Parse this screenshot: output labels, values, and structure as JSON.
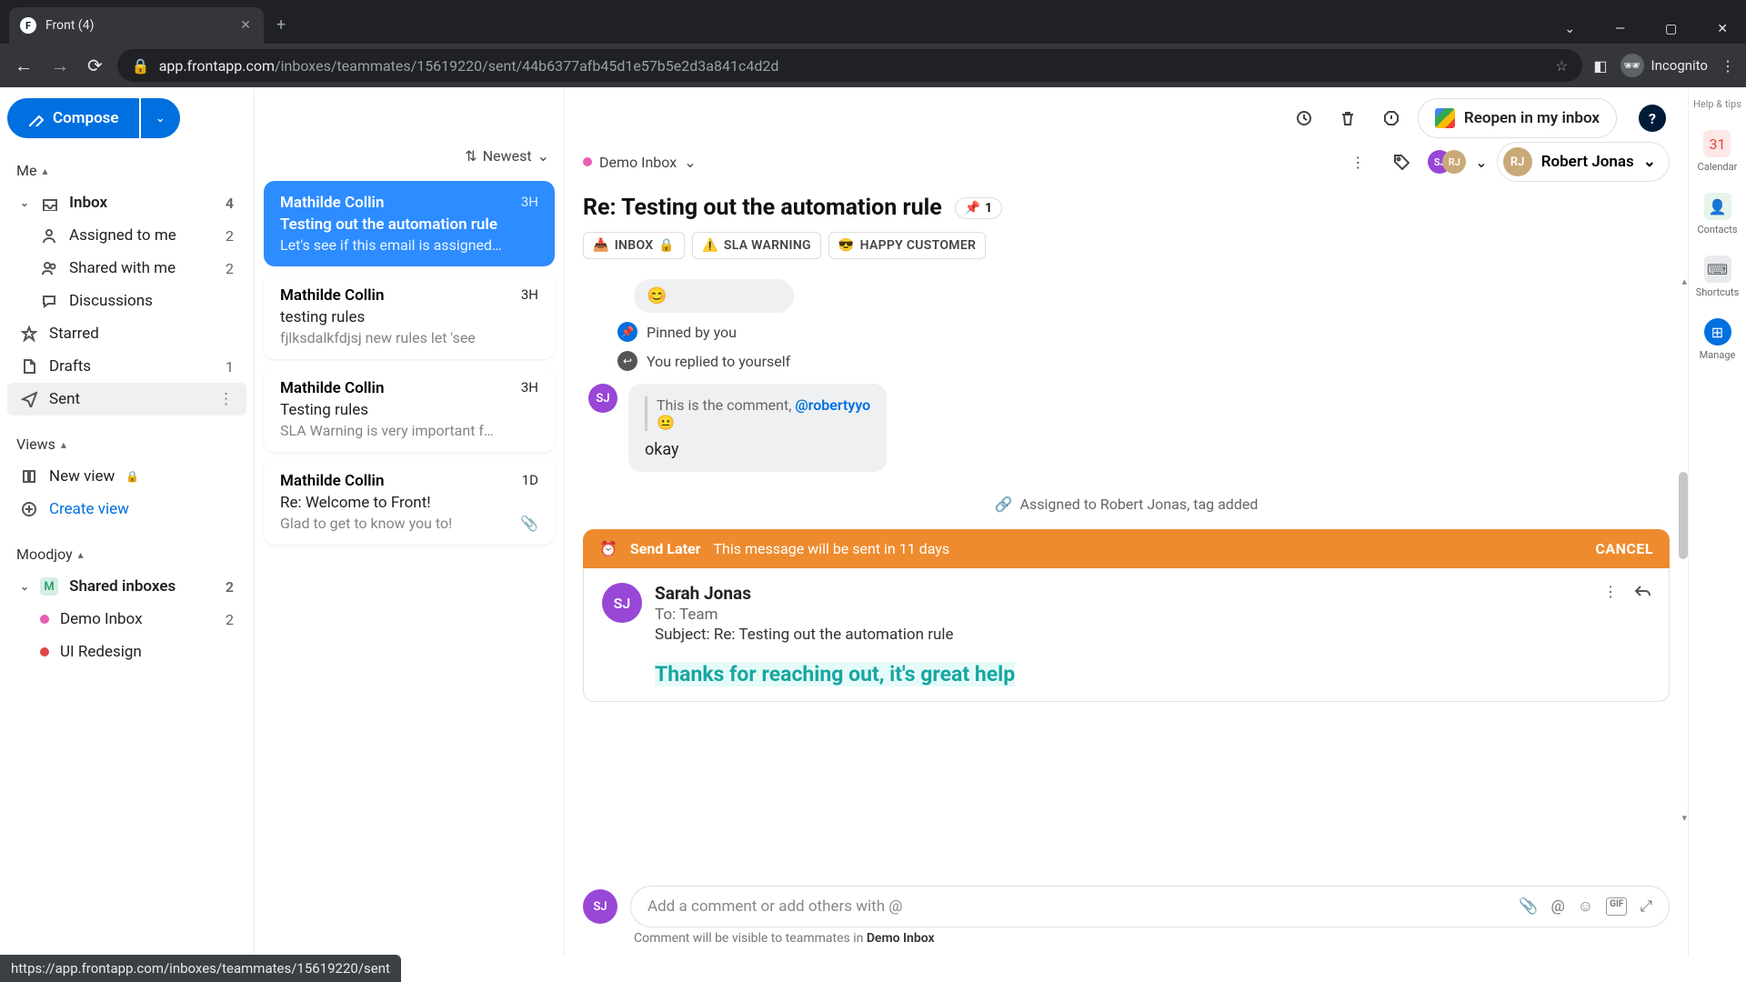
{
  "browser": {
    "tab_title": "Front (4)",
    "url_host": "app.frontapp.com",
    "url_path": "/inboxes/teammates/15619220/sent/44b6377afb45d1e57b5e2d3a841c4d2d",
    "incognito": "Incognito"
  },
  "sidebar": {
    "compose": "Compose",
    "me": "Me",
    "inbox": {
      "label": "Inbox",
      "count": "4"
    },
    "assigned": {
      "label": "Assigned to me",
      "count": "2"
    },
    "shared": {
      "label": "Shared with me",
      "count": "2"
    },
    "discussions": "Discussions",
    "starred": "Starred",
    "drafts": {
      "label": "Drafts",
      "count": "1"
    },
    "sent": "Sent",
    "views": "Views",
    "new_view": "New view",
    "create_view": "Create view",
    "moodjoy": "Moodjoy",
    "shared_inboxes": {
      "label": "Shared inboxes",
      "count": "2"
    },
    "demo_inbox": {
      "label": "Demo Inbox",
      "count": "2"
    },
    "ui_redesign": "UI Redesign"
  },
  "list": {
    "sort": "Newest",
    "items": [
      {
        "sender": "Mathilde Collin",
        "time": "3H",
        "subject": "Testing out the automation rule",
        "preview": "Let's see if this email is assigned…"
      },
      {
        "sender": "Mathilde Collin",
        "time": "3H",
        "subject": "testing rules",
        "preview": "fjlksdalkfdjsj new rules let 'see"
      },
      {
        "sender": "Mathilde Collin",
        "time": "3H",
        "subject": "Testing rules",
        "preview": "SLA Warning is very important f…"
      },
      {
        "sender": "Mathilde Collin",
        "time": "1D",
        "subject": "Re: Welcome to Front!",
        "preview": "Glad to get to know you to!"
      }
    ]
  },
  "header": {
    "demo_inbox": "Demo Inbox",
    "reopen": "Reopen in my inbox",
    "help_tips": "Help & tips",
    "assignee": "Robert Jonas",
    "subject": "Re: Testing out the automation rule",
    "pin_count": "1",
    "tags": {
      "inbox": "INBOX",
      "sla": "SLA WARNING",
      "happy": "HAPPY CUSTOMER"
    }
  },
  "thread": {
    "pinned": "Pinned by you",
    "replied": "You replied to yourself",
    "comment_text": "This is the comment, ",
    "mention": "@robertyyo",
    "okay": "okay",
    "assigned_note": "Assigned to Robert Jonas, tag added",
    "send_later_label": "Send Later",
    "send_later_msg": "This message will be sent in 11 days",
    "cancel": "CANCEL",
    "draft_from": "Sarah Jonas",
    "draft_to_label": "To: ",
    "draft_to": "Team",
    "draft_subject_label": "Subject: ",
    "draft_subject": "Re: Testing out the automation rule",
    "draft_body": "Thanks for reaching out, it's great help",
    "comment_placeholder": "Add a comment or add others with @",
    "visibility_pre": "Comment will be visible to teammates in ",
    "visibility_inbox": "Demo Inbox"
  },
  "rail": {
    "calendar": "Calendar",
    "contacts": "Contacts",
    "shortcuts": "Shortcuts",
    "manage": "Manage"
  },
  "status_url": "https://app.frontapp.com/inboxes/teammates/15619220/sent"
}
